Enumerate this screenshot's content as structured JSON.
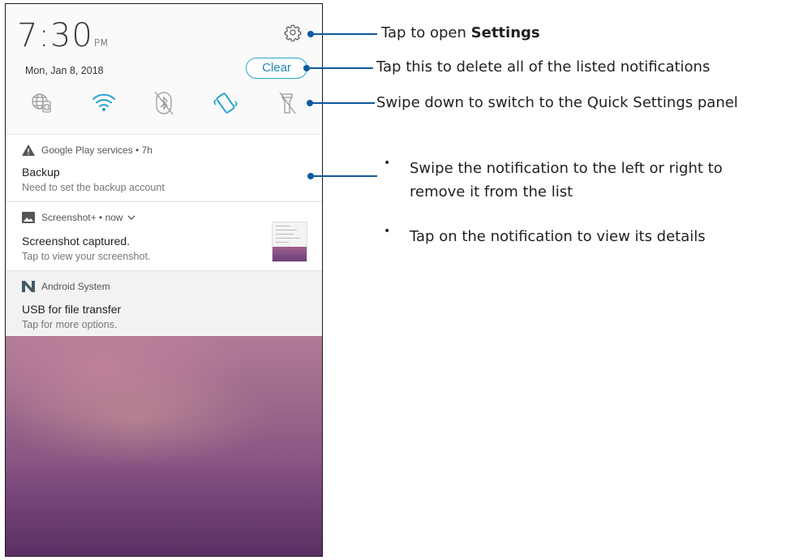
{
  "status": {
    "time": "7:30",
    "ampm": "PM",
    "date": "Mon, Jan 8, 2018",
    "clear_label": "Clear"
  },
  "quick_settings": {
    "icons": [
      "globe-sim-icon",
      "wifi-icon",
      "bluetooth-off-icon",
      "vibrate-icon",
      "flashlight-off-icon"
    ],
    "accent": "#27a3d0"
  },
  "notifications": [
    {
      "app": "Google Play services • 7h",
      "title": "Backup",
      "text": "Need to set the backup account",
      "icon": "warning-icon"
    },
    {
      "app": "Screenshot+ • now",
      "title": "Screenshot captured.",
      "text": "Tap to view your screenshot.",
      "icon": "image-icon"
    },
    {
      "app": "Android System",
      "title": "USB for file transfer",
      "text": "Tap for more options.",
      "icon": "android-n-icon"
    }
  ],
  "callouts": {
    "settings_prefix": "Tap to open ",
    "settings_bold": "Settings",
    "clear": "Tap this to delete all of the listed notifications",
    "quick_settings": "Swipe down to switch to the Quick Settings panel",
    "bullet_1": "Swipe the notification to the left or right to remove it from the list",
    "bullet_2": "Tap on the notification to view its details",
    "bullet_mark": "•",
    "line_color": "#0d5a9e"
  }
}
